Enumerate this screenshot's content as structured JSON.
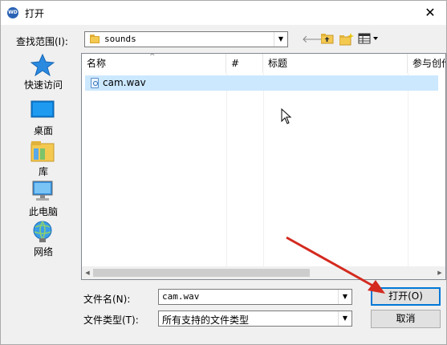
{
  "window": {
    "title": "打开",
    "app_icon": "WD"
  },
  "lookin": {
    "label": "查找范围(I):",
    "value": "sounds"
  },
  "toolbar": {
    "back_icon": "back-arrow-icon",
    "up_icon": "up-folder-icon",
    "new_folder_icon": "new-folder-icon",
    "view_icon": "view-menu-icon"
  },
  "places": [
    {
      "label": "快速访问",
      "icon": "star-icon"
    },
    {
      "label": "桌面",
      "icon": "desktop-icon"
    },
    {
      "label": "库",
      "icon": "library-icon"
    },
    {
      "label": "此电脑",
      "icon": "computer-icon"
    },
    {
      "label": "网络",
      "icon": "network-icon"
    }
  ],
  "filelist": {
    "columns": [
      "名称",
      "#",
      "标题",
      "参与创作"
    ],
    "rows": [
      {
        "name": "cam.wav"
      }
    ]
  },
  "filename": {
    "label": "文件名(N):",
    "value": "cam.wav"
  },
  "filetype": {
    "label": "文件类型(T):",
    "value": "所有支持的文件类型"
  },
  "buttons": {
    "open": "打开(O)",
    "cancel": "取消"
  },
  "colors": {
    "accent": "#0078d7",
    "selection": "#cce8ff",
    "annotation_arrow": "#d42a1f"
  }
}
